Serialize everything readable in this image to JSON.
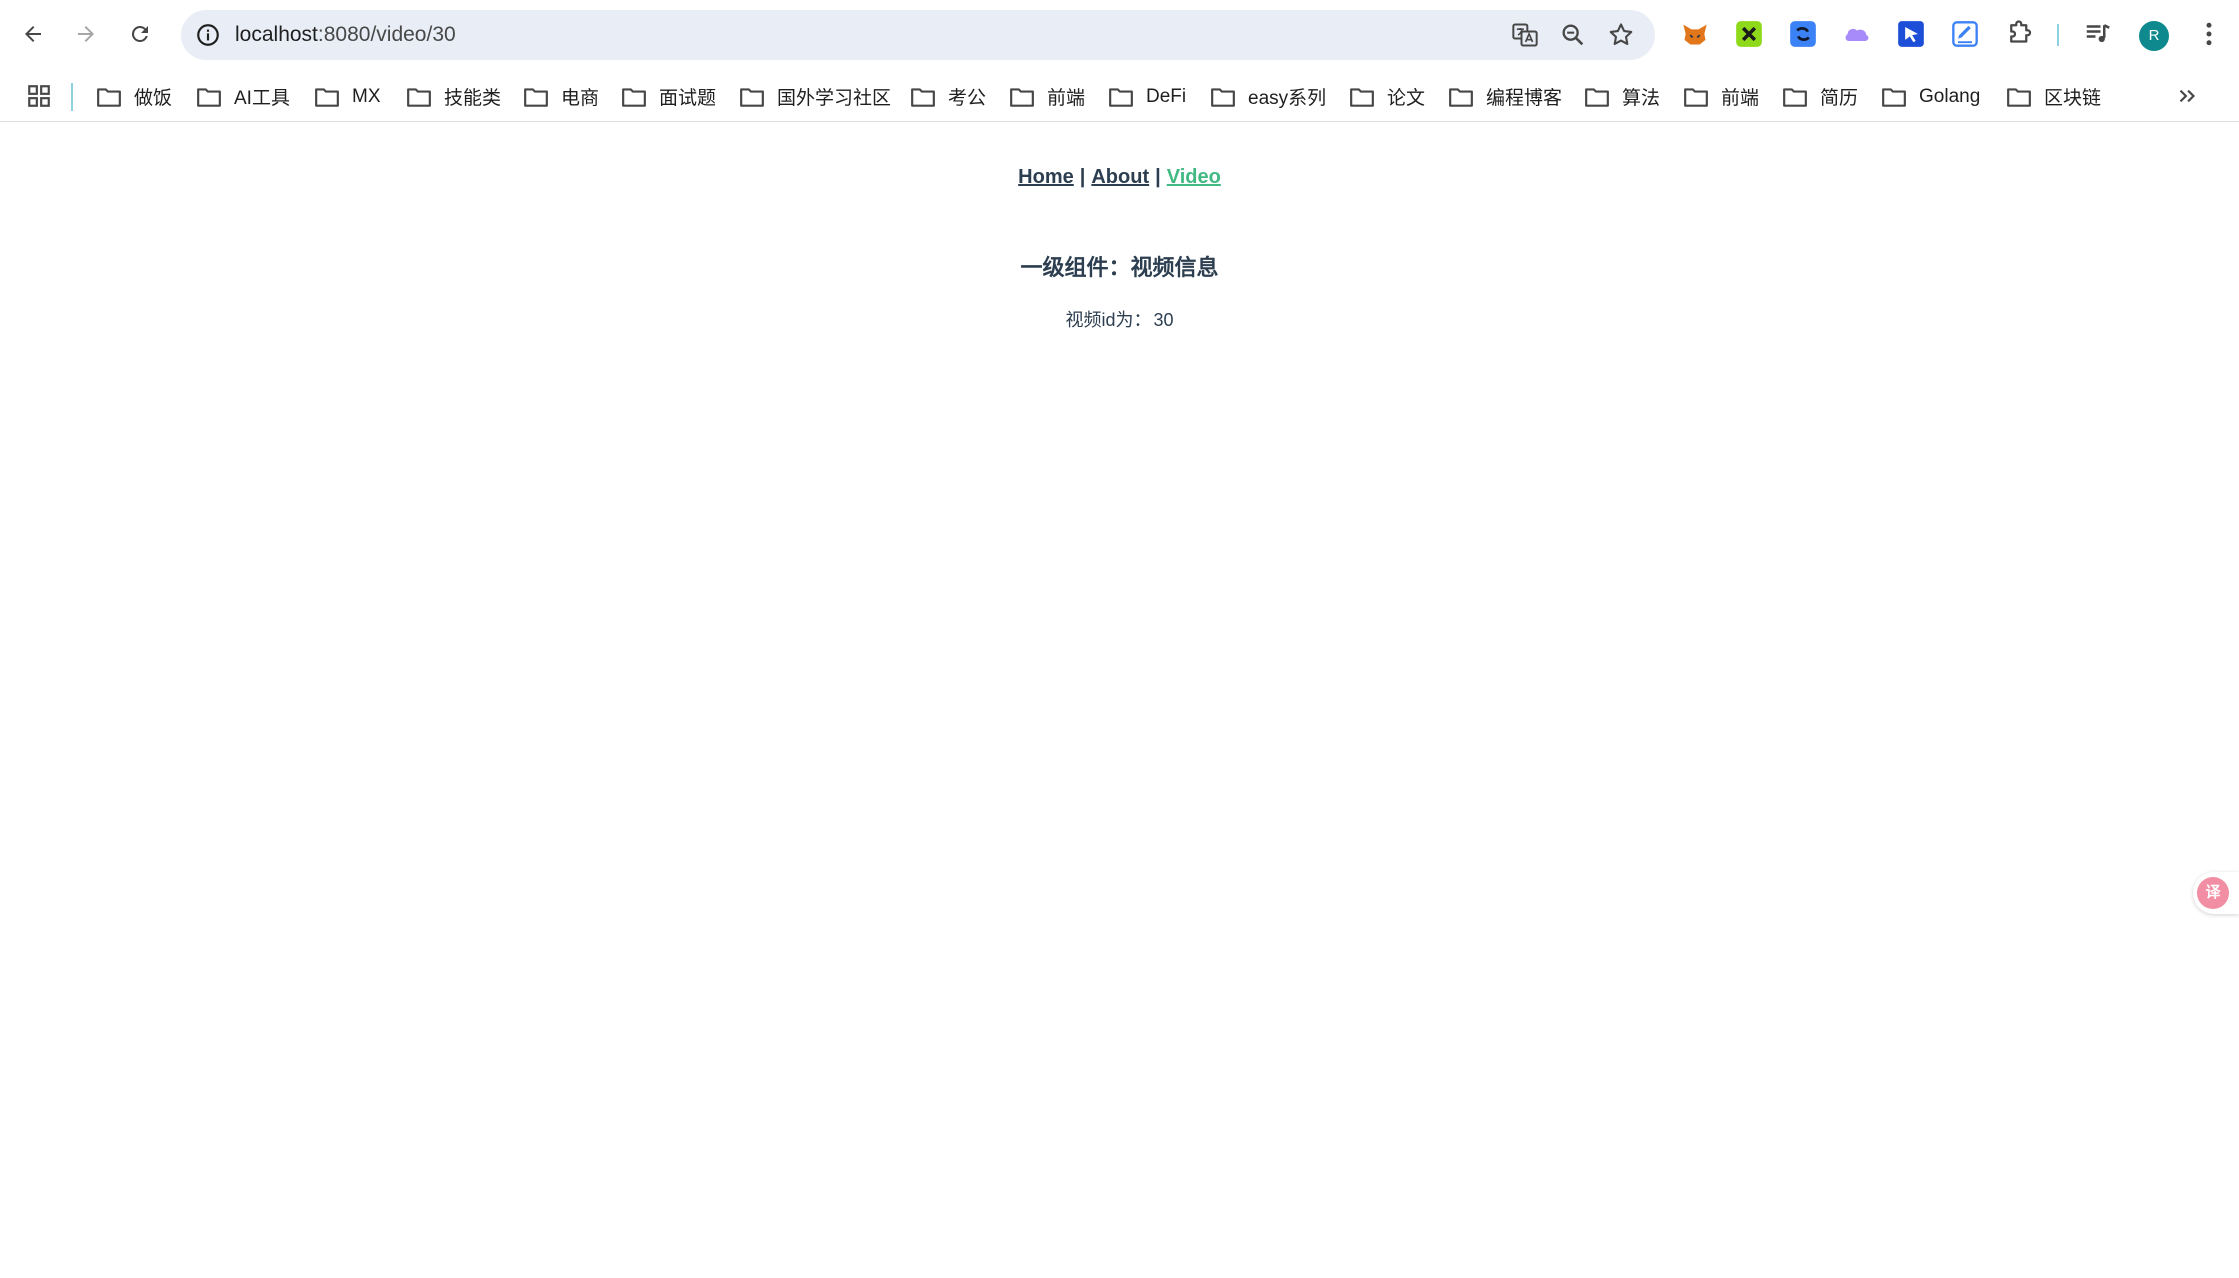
{
  "browser": {
    "url_host": "localhost",
    "url_path": ":8080/video/30",
    "profile_initial": "R",
    "extensions": [
      {
        "name": "fox-extension-icon",
        "color": "#e2761b"
      },
      {
        "name": "green-grid-extension-icon",
        "color": "#8dd91a"
      },
      {
        "name": "blue-swirl-extension-icon",
        "color": "#3b82f6"
      },
      {
        "name": "purple-cloud-extension-icon",
        "color": "#a78bfa"
      },
      {
        "name": "blue-cursor-extension-icon",
        "color": "#1d4ed8"
      },
      {
        "name": "edit-note-extension-icon",
        "color": "#3b82f6"
      }
    ]
  },
  "bookmarks": [
    {
      "label": "做饭"
    },
    {
      "label": "AI工具"
    },
    {
      "label": "MX"
    },
    {
      "label": "技能类"
    },
    {
      "label": "电商"
    },
    {
      "label": "面试题"
    },
    {
      "label": "国外学习社区"
    },
    {
      "label": "考公"
    },
    {
      "label": "前端"
    },
    {
      "label": "DeFi"
    },
    {
      "label": "easy系列"
    },
    {
      "label": "论文"
    },
    {
      "label": "编程博客"
    },
    {
      "label": "算法"
    },
    {
      "label": "前端"
    },
    {
      "label": "简历"
    },
    {
      "label": "Golang"
    },
    {
      "label": "区块链"
    }
  ],
  "page": {
    "nav": {
      "home": "Home",
      "about": "About",
      "video": "Video",
      "separator": "|"
    },
    "title": "一级组件：视频信息",
    "video_id_label": "视频id为：",
    "video_id_value": "30",
    "translate_badge": "译"
  },
  "colors": {
    "text": "#2c3e50",
    "active_link": "#42b983",
    "omnibox_bg": "#e9eef6"
  }
}
